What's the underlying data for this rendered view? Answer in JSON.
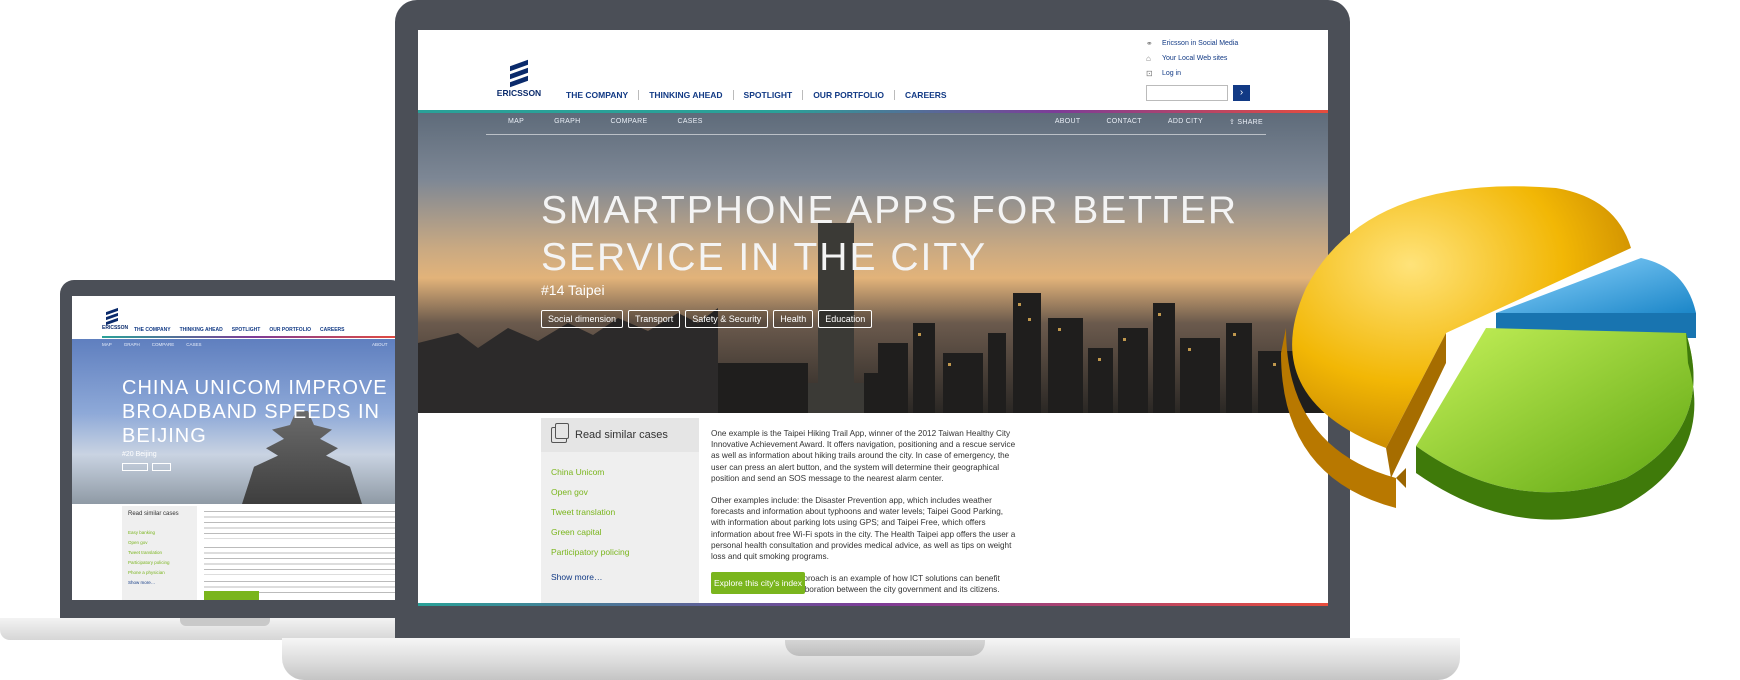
{
  "left_screen": {
    "logo_word": "ERICSSON",
    "nav": [
      "THE COMPANY",
      "THINKING AHEAD",
      "SPOTLIGHT",
      "OUR PORTFOLIO",
      "CAREERS"
    ],
    "subnav": [
      "MAP",
      "GRAPH",
      "COMPARE",
      "CASES"
    ],
    "subnav_right": "ABOUT",
    "title": "CHINA UNICOM IMPROVE BROADBAND SPEEDS IN BEIJING",
    "rank": "#20 Beijing",
    "sidebar_title": "Read similar cases",
    "sidebar_links": [
      "Easy banking",
      "Open gov",
      "Tweet translation",
      "Participatory policing",
      "Phone a physician"
    ],
    "sidebar_more": "Show more…"
  },
  "main_screen": {
    "logo_word": "ERICSSON",
    "nav": [
      "THE COMPANY",
      "THINKING AHEAD",
      "SPOTLIGHT",
      "OUR PORTFOLIO",
      "CAREERS"
    ],
    "utility_links": [
      "Ericsson in Social Media",
      "Your Local Web sites",
      "Log in"
    ],
    "search_placeholder": "",
    "search_button": "›",
    "subnav_left": [
      "MAP",
      "GRAPH",
      "COMPARE",
      "CASES"
    ],
    "subnav_right": [
      "ABOUT",
      "CONTACT",
      "ADD CITY",
      "SHARE"
    ],
    "hero_title": "SMARTPHONE APPS FOR BETTER SERVICE IN THE CITY",
    "hero_rank": "#14 Taipei",
    "tags": [
      "Social dimension",
      "Transport",
      "Safety & Security",
      "Health",
      "Education"
    ],
    "sidebar_title": "Read similar cases",
    "sidebar_links": [
      "China Unicom",
      "Open gov",
      "Tweet translation",
      "Green capital",
      "Participatory policing"
    ],
    "sidebar_more": "Show more…",
    "paragraphs": [
      "One example is the Taipei Hiking Trail App, winner of the 2012 Taiwan Healthy City Innovative Achievement Award. It offers navigation, positioning and a rescue service as well as information about hiking trails around the city. In case of emergency, the user can press an alert button, and the system will determine their geographical position and send an SOS message to the nearest alarm center.",
      "Other examples include: the Disaster Prevention app, which includes weather forecasts and information about typhoons and water levels; Taipei Good Parking, with information about parking lots using GPS; and Taipei Free, which offers information about free Wi-Fi spots in the city. The Health Taipei app offers the user a personal health consultation and provides medical advice, as well as tips on weight loss and quit smoking programs.",
      "This new collaborative approach is an example of how ICT solutions can benefit society and increase collaboration between the city government and its citizens."
    ],
    "cta": "Explore this city's index"
  },
  "colors": {
    "brand_blue": "#123a85",
    "accent_green": "#7ab51d",
    "laptop_frame": "#4b4f57"
  },
  "pie_graphic": {
    "slices": [
      {
        "color": "#f2b705",
        "share": 0.62
      },
      {
        "color": "#3ba9e6",
        "share": 0.08
      },
      {
        "color": "#8bd124",
        "share": 0.3
      }
    ]
  }
}
